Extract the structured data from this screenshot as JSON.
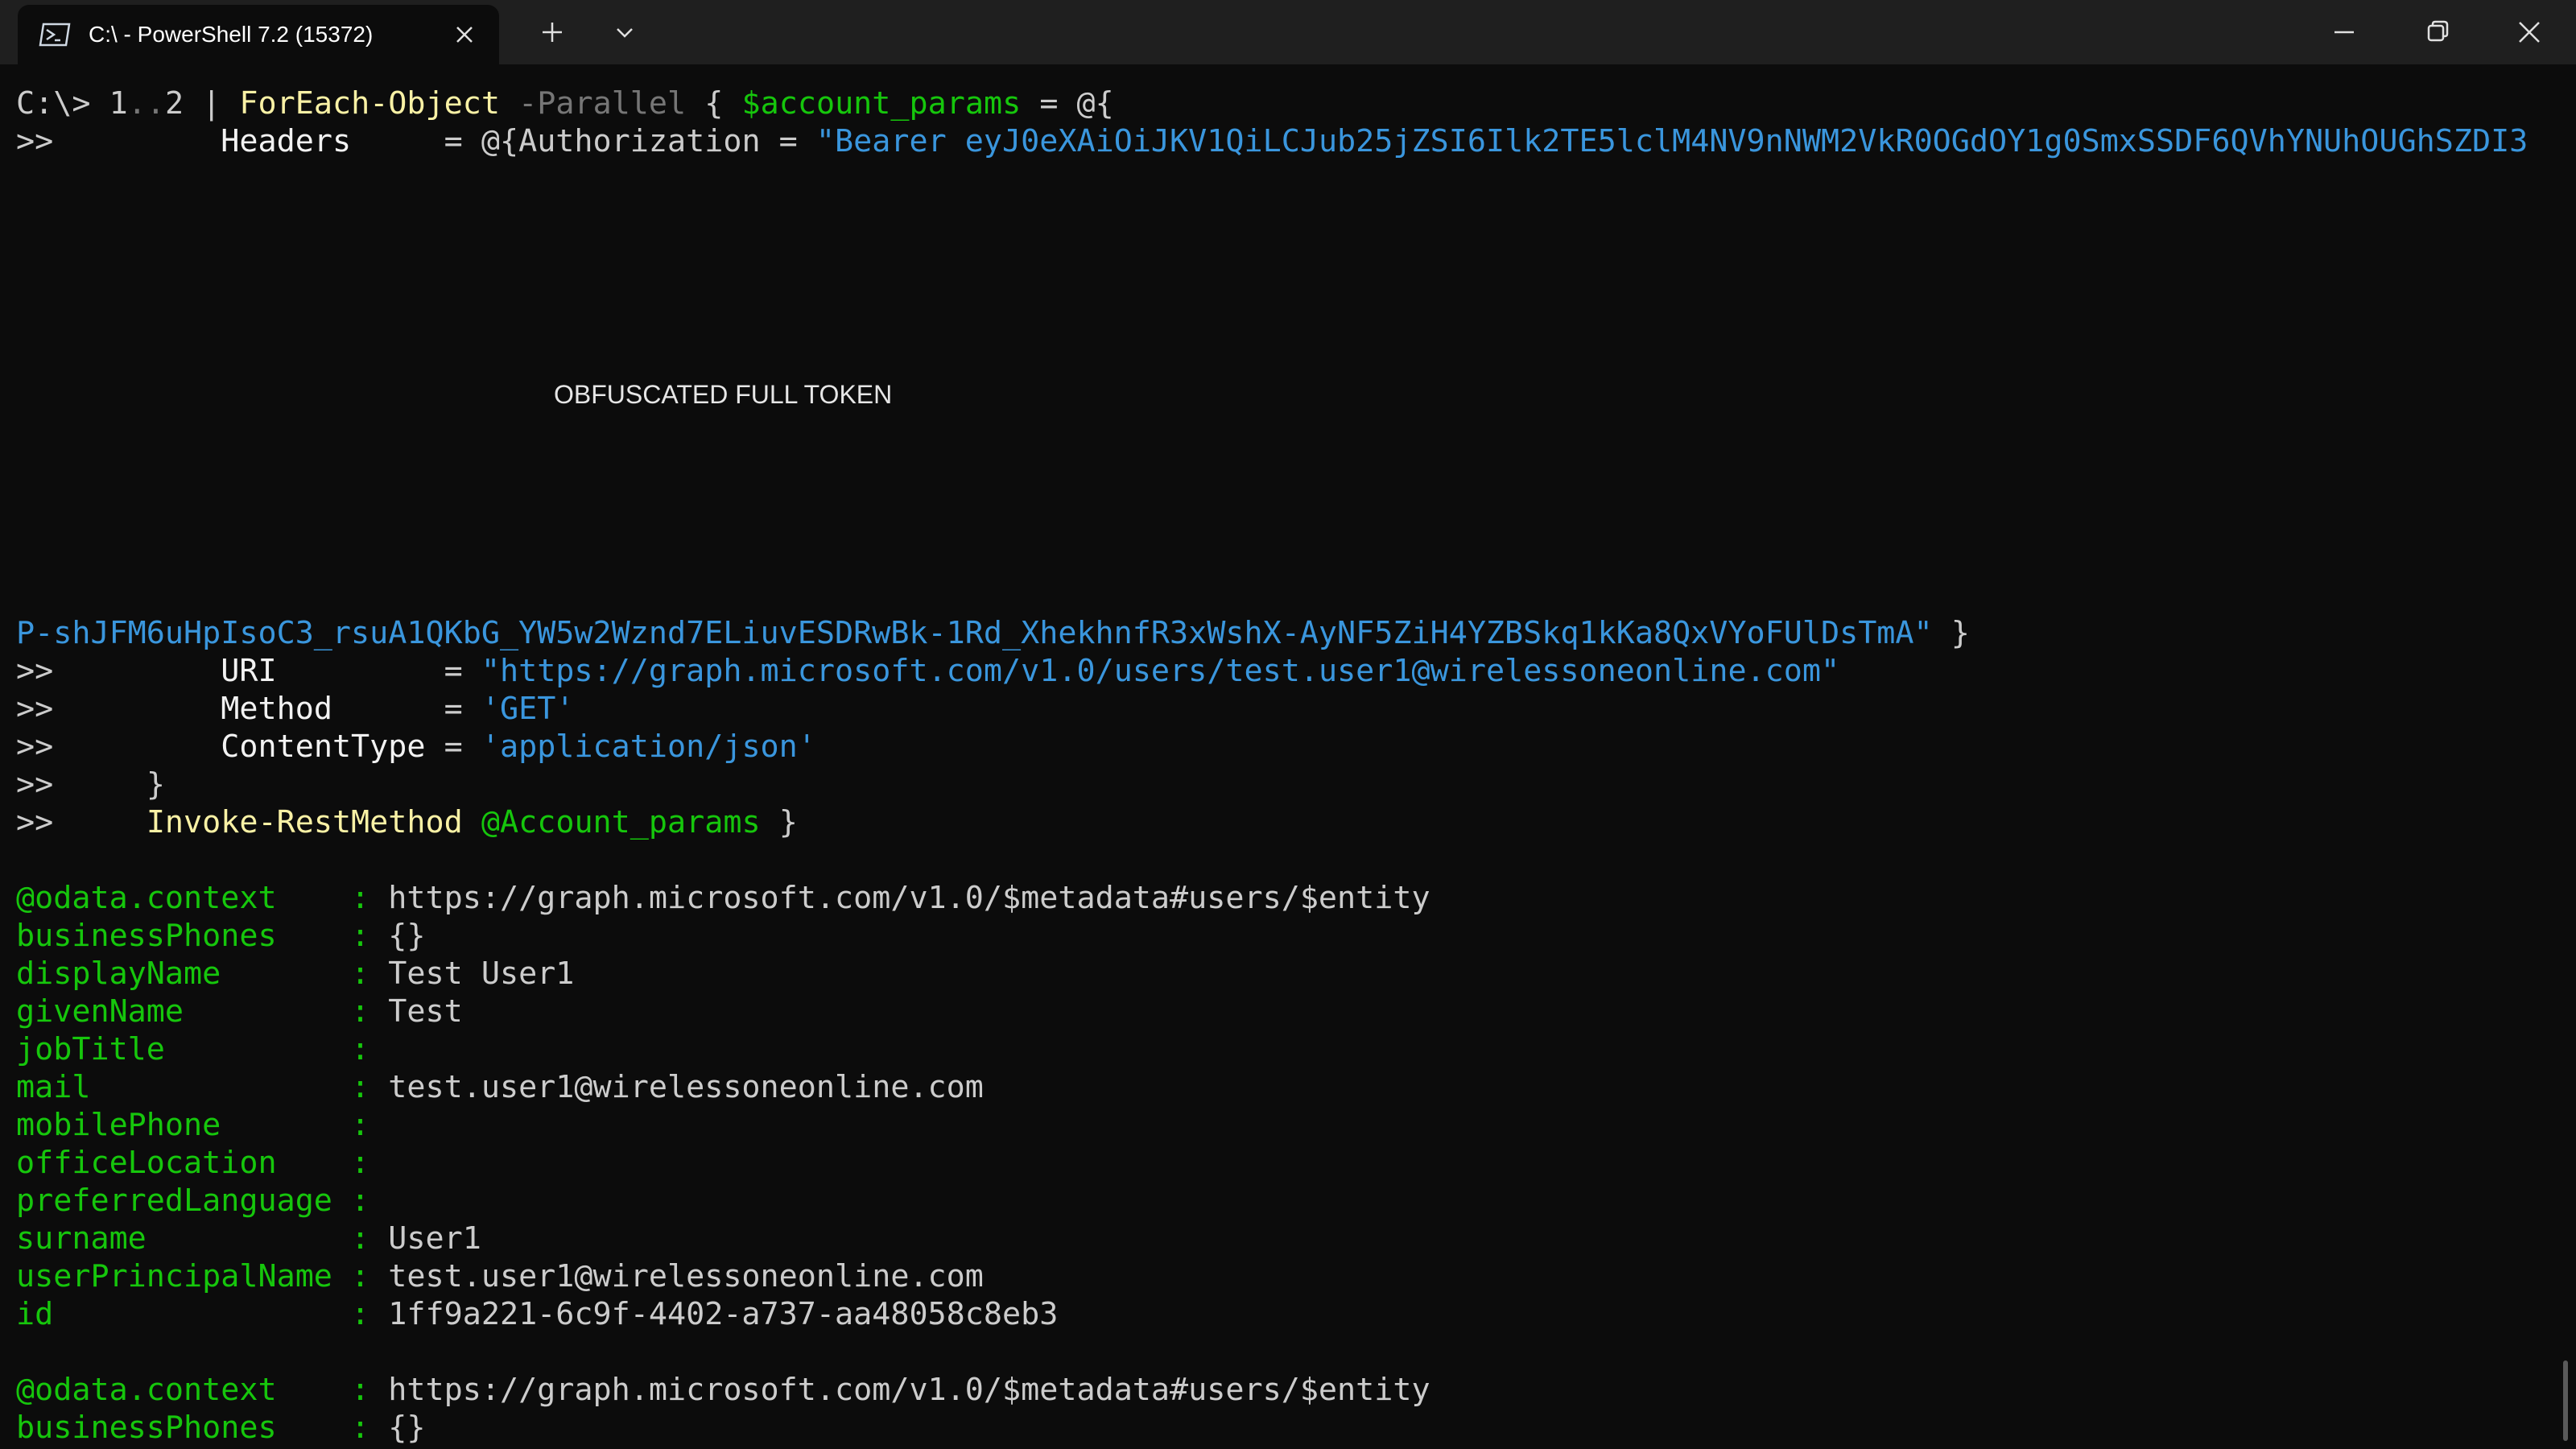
{
  "window": {
    "tab_title": "C:\\ - PowerShell 7.2 (15372)",
    "new_tab_label": "+",
    "icons": [
      "powershell-icon",
      "close-tab-icon",
      "new-tab-icon",
      "dropdown-icon",
      "minimize-icon",
      "restore-icon",
      "close-window-icon"
    ]
  },
  "overlay_text": "OBFUSCATED FULL TOKEN",
  "command": {
    "prompt": "C:\\> ",
    "range_start": "1",
    "range_dots": "..",
    "range_end": "2",
    "pipe": " | ",
    "cmdlet": "ForEach-Object",
    "param": "-Parallel",
    "brace_open": " { ",
    "var": "$account_params",
    "assign": " = @{",
    "cont": ">>",
    "headers_key": "Headers",
    "headers_eq": "     = @{Authorization = ",
    "token_start": "\"Bearer eyJ0eXAiOiJKV1QiLCJub25jZSI6Ilk2TE5lclM4NV9nNWM2VkR0OGdOY1g0SmxSSDF6QVhYNUhOUGhSZDI3",
    "token_end": "P-shJFM6uHpIsoC3_rsuA1QKbG_YW5w2Wznd7ELiuvESDRwBk-1Rd_XhekhnfR3xWshX-AyNF5ZiH4YZBSkq1kKa8QxVYoFUlDsTmA\"",
    "token_close": " }",
    "uri_key": "URI",
    "uri_eq": "         = ",
    "uri_val": "\"https://graph.microsoft.com/v1.0/users/test.user1@wirelessoneonline.com\"",
    "method_key": "Method",
    "method_eq": "      = ",
    "method_val": "'GET'",
    "ct_key": "ContentType",
    "ct_eq": " = ",
    "ct_val": "'application/json'",
    "close_brace": "}",
    "invoke": "Invoke-RestMethod",
    "splat": "@Account_params",
    "final_close": " }"
  },
  "output1": [
    {
      "key": "@odata.context    ",
      "val": "https://graph.microsoft.com/v1.0/$metadata#users/$entity"
    },
    {
      "key": "businessPhones    ",
      "val": "{}"
    },
    {
      "key": "displayName       ",
      "val": "Test User1"
    },
    {
      "key": "givenName         ",
      "val": "Test"
    },
    {
      "key": "jobTitle          ",
      "val": ""
    },
    {
      "key": "mail              ",
      "val": "test.user1@wirelessoneonline.com"
    },
    {
      "key": "mobilePhone       ",
      "val": ""
    },
    {
      "key": "officeLocation    ",
      "val": ""
    },
    {
      "key": "preferredLanguage ",
      "val": ""
    },
    {
      "key": "surname           ",
      "val": "User1"
    },
    {
      "key": "userPrincipalName ",
      "val": "test.user1@wirelessoneonline.com"
    },
    {
      "key": "id                ",
      "val": "1ff9a221-6c9f-4402-a737-aa48058c8eb3"
    }
  ],
  "output2": [
    {
      "key": "@odata.context    ",
      "val": "https://graph.microsoft.com/v1.0/$metadata#users/$entity"
    },
    {
      "key": "businessPhones    ",
      "val": "{}"
    }
  ]
}
